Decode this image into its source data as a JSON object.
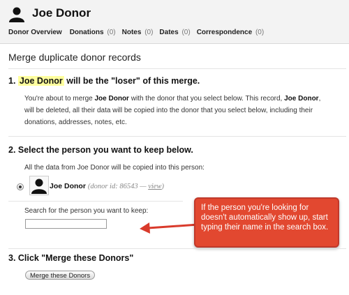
{
  "header": {
    "donor_name": "Joe Donor",
    "avatar_icon": "person-silhouette-icon",
    "tabs": [
      {
        "label": "Donor Overview",
        "count": ""
      },
      {
        "label": "Donations",
        "count": "(0)"
      },
      {
        "label": "Notes",
        "count": "(0)"
      },
      {
        "label": "Dates",
        "count": "(0)"
      },
      {
        "label": "Correspondence",
        "count": "(0)"
      }
    ]
  },
  "page_title": "Merge duplicate donor records",
  "step1": {
    "number": "1.",
    "name": "Joe Donor",
    "rest": "will be the \"loser\" of this merge.",
    "text_1": "You're about to merge ",
    "bold_1": "Joe Donor",
    "text_2": " with the donor that you select below. This record, ",
    "bold_2": "Joe Donor",
    "text_3": ", will be deleted, all their data will be copied into the donor that you select below, including their donations, addresses, notes, etc."
  },
  "step2": {
    "title": "2. Select the person you want to keep below.",
    "description": "All the data from Joe Donor will be copied into this person:",
    "person_name": "Joe Donor",
    "donor_id_text": "(donor id: 86543 —",
    "view_link": "view",
    "close_paren": ")",
    "search_label": "Search for the person you want to keep:",
    "search_value": ""
  },
  "callout": {
    "text": "If the person you're looking for doesn't automatically show up, start typing their name in the search box.",
    "color": "#e24830"
  },
  "step3": {
    "title": "3. Click \"Merge these Donors\"",
    "button_label": "Merge these Donors"
  }
}
